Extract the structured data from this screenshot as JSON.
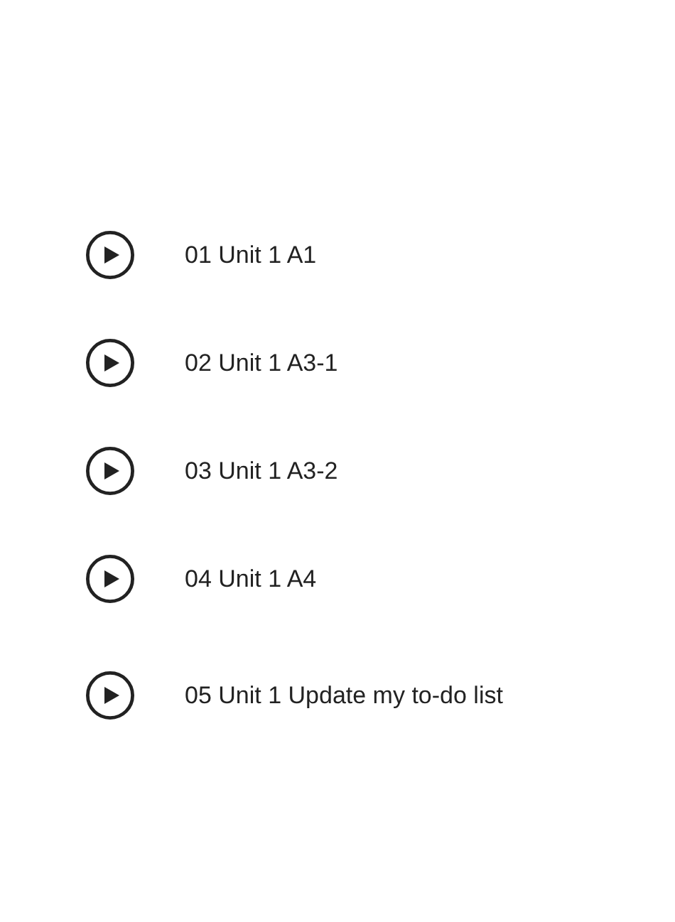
{
  "tracks": [
    {
      "label": "01 Unit 1 A1"
    },
    {
      "label": "02 Unit 1 A3-1"
    },
    {
      "label": "03 Unit 1 A3-2"
    },
    {
      "label": "04 Unit 1 A4"
    },
    {
      "label": "05 Unit 1 Update my to-do list"
    }
  ]
}
